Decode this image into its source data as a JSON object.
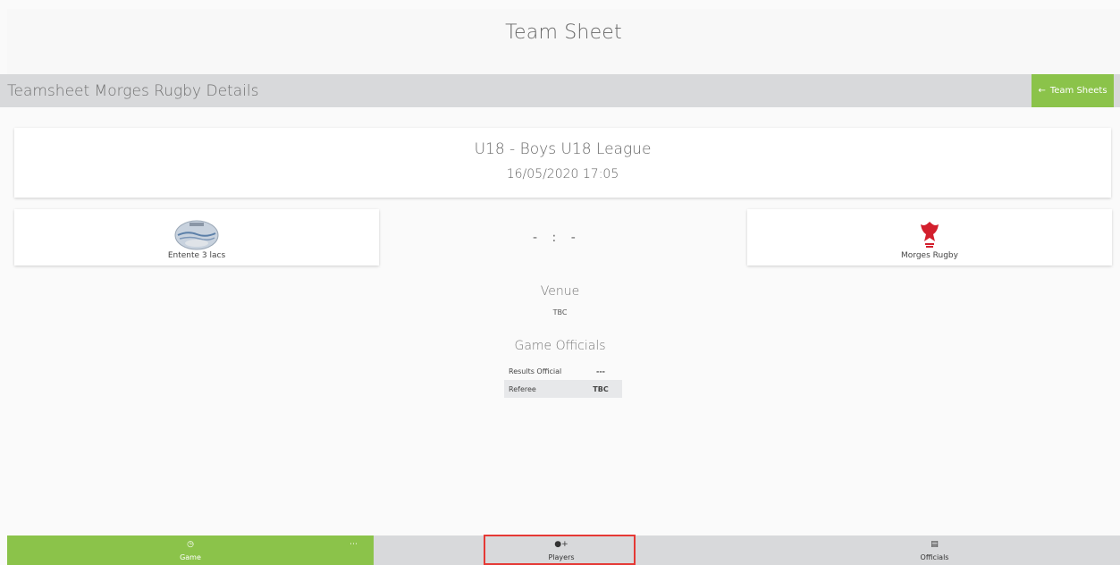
{
  "page": {
    "title": "Team Sheet"
  },
  "subheader": {
    "title": "Teamsheet Morges Rugby Details",
    "back_label": "Team Sheets"
  },
  "match": {
    "league": "U18 - Boys U18 League",
    "date": "16/05/2020",
    "time": "17:05",
    "score_home": "-",
    "score_sep": ":",
    "score_away": "-"
  },
  "teams": {
    "home": {
      "name": "Entente 3 lacs",
      "logo_icon": "entente-3-lacs-logo"
    },
    "away": {
      "name": "Morges Rugby",
      "logo_icon": "morges-rugby-logo"
    }
  },
  "venue": {
    "heading": "Venue",
    "value": "TBC"
  },
  "officials": {
    "heading": "Game Officials",
    "rows": [
      {
        "label": "Results Official",
        "value": "---"
      },
      {
        "label": "Referee",
        "value": "TBC"
      }
    ]
  },
  "bottom_nav": {
    "game": {
      "label": "Game",
      "icon": "clock-icon"
    },
    "players": {
      "label": "Players",
      "icon": "add-user-icon"
    },
    "officials": {
      "label": "Officials",
      "icon": "id-card-icon"
    }
  },
  "colors": {
    "accent": "#8bc34a",
    "highlight": "#e53935",
    "bar": "#d8d9db"
  }
}
